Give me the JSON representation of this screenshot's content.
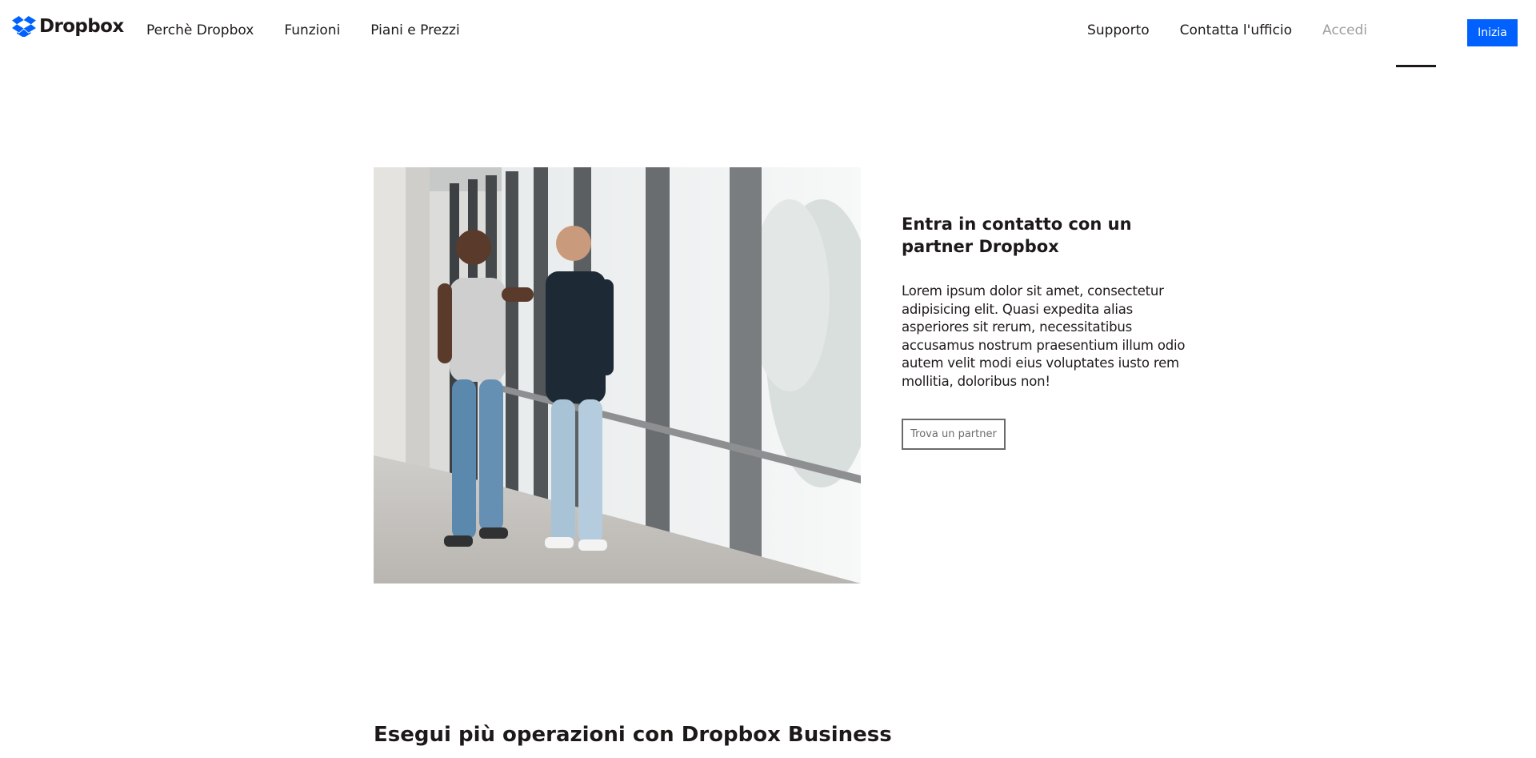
{
  "brand": {
    "name": "Dropbox",
    "logo_icon": "dropbox-logo-icon",
    "color": "#0061fe"
  },
  "nav": {
    "left": [
      {
        "label": "Perchè Dropbox"
      },
      {
        "label": "Funzioni"
      },
      {
        "label": "Piani e Prezzi"
      }
    ],
    "right": {
      "support": "Supporto",
      "contact": "Contatta l'ufficio",
      "signin": "Accedi",
      "start": "Inizia"
    }
  },
  "partner": {
    "title": "Entra in contatto con un partner Dropbox",
    "body": "Lorem ipsum dolor sit amet, consectetur adipisicing elit. Quasi expedita alias asperiores sit rerum, necessitatibus accusamus nostrum praesentium illum odio autem velit modi eius voluptates iusto rem mollitia, doloribus non!",
    "button": "Trova un partner"
  },
  "business": {
    "heading": "Esegui più operazioni con Dropbox Business"
  },
  "colors": {
    "accent": "#0061fe",
    "text": "#1e1919",
    "muted": "#9f9f9f"
  }
}
